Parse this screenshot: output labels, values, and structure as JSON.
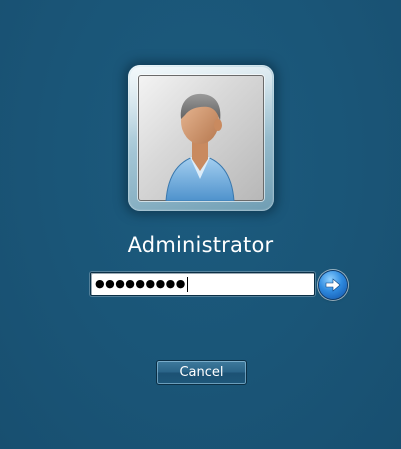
{
  "login": {
    "username": "Administrator",
    "password_masked": "●●●●●●●●●",
    "submit_icon": "arrow-right-icon",
    "cancel_label": "Cancel",
    "avatar_icon": "user-avatar-icon"
  },
  "colors": {
    "background": "#1a5577",
    "accent": "#2f8be0",
    "text": "#ffffff"
  }
}
